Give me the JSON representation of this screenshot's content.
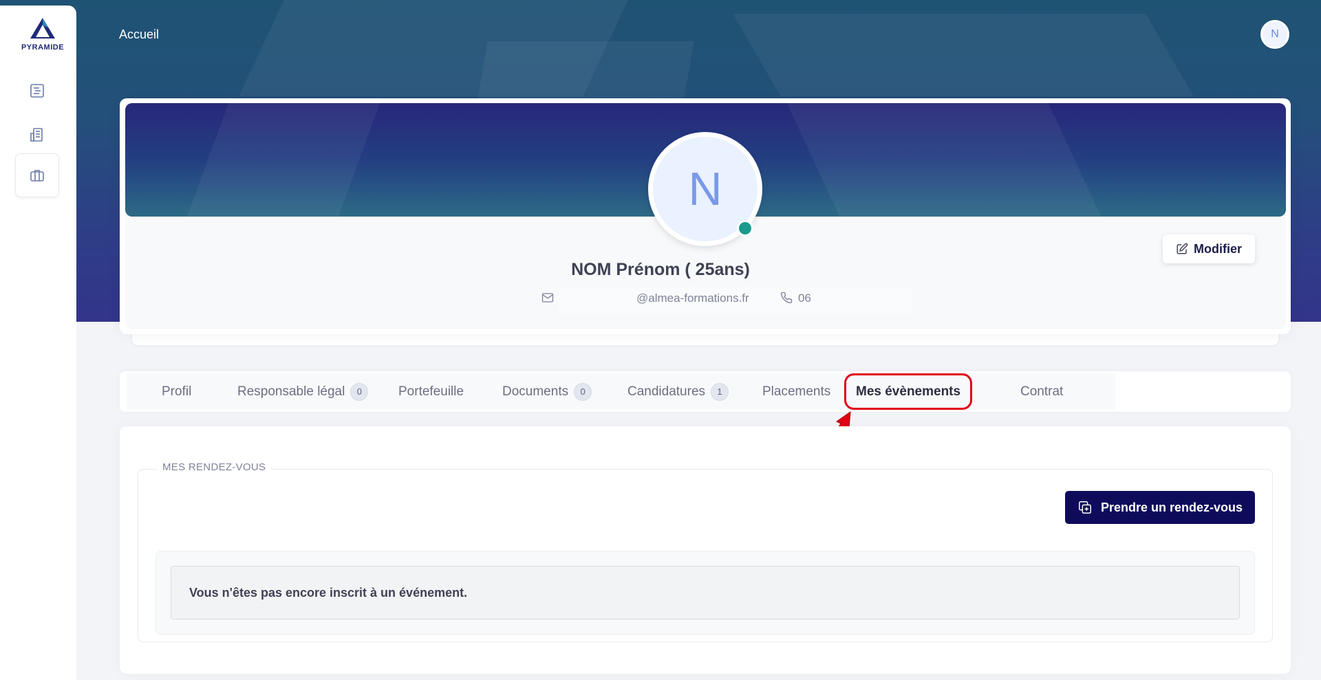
{
  "app": {
    "logo_text": "PYRAMIDE"
  },
  "header": {
    "breadcrumb": "Accueil",
    "user_initial": "N"
  },
  "profile": {
    "initial": "N",
    "name": "NOM Prénom ( 25ans)",
    "email": "@almea-formations.fr",
    "phone": "06",
    "edit_label": "Modifier"
  },
  "tabs": [
    {
      "label": "Profil"
    },
    {
      "label": "Responsable légal",
      "badge": "0"
    },
    {
      "label": "Portefeuille"
    },
    {
      "label": "Documents",
      "badge": "0"
    },
    {
      "label": "Candidatures",
      "badge": "1"
    },
    {
      "label": "Placements"
    },
    {
      "label": "Mes évènements"
    },
    {
      "label": "Contrat"
    }
  ],
  "events": {
    "section_title": "MES RENDEZ-VOUS",
    "action_label": "Prendre un rendez-vous",
    "empty_message": "Vous n'êtes pas encore inscrit à un événement."
  },
  "colors": {
    "primary": "#0e0b5b",
    "annotation": "#e00015",
    "status_online": "#1a9b8c"
  },
  "icons": [
    "list-icon",
    "building-icon",
    "briefcase-icon",
    "edit-icon",
    "mail-icon",
    "phone-icon",
    "calendar-add-icon"
  ]
}
